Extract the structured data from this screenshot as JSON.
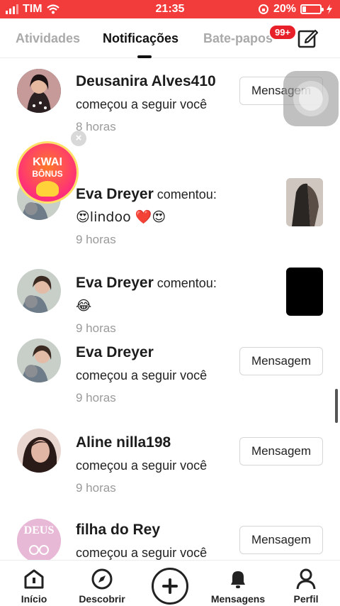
{
  "status_bar": {
    "carrier": "TIM",
    "time": "21:35",
    "battery": "20%",
    "battery_level": 0.2
  },
  "tabs": [
    {
      "label": "Atividades"
    },
    {
      "label": "Notificações"
    },
    {
      "label": "Bate-papos"
    }
  ],
  "chat_badge": "99+",
  "kwai_bonus": {
    "line1": "KWAI",
    "line2": "BÔNUS",
    "close": "×"
  },
  "notifications": [
    {
      "user": "Deusanira Alves410",
      "action": "começou a seguir você",
      "time": "8 horas",
      "button": "Mensagem"
    },
    {
      "user": "Eva Dreyer",
      "action": "comentou:",
      "comment": "😍lindoo ❤️😍",
      "time": "9 horas"
    },
    {
      "user": "Eva Dreyer",
      "action": "comentou:",
      "comment": "😂",
      "time": "9 horas"
    },
    {
      "user": "Eva Dreyer",
      "action": "começou a seguir você",
      "time": "9 horas",
      "button": "Mensagem"
    },
    {
      "user": "Aline nilla198",
      "action": "começou a seguir você",
      "time": "9 horas",
      "button": "Mensagem"
    },
    {
      "user": "filha do Rey",
      "action": "começou a seguir você",
      "button": "Mensagem",
      "avatar_text": "DEUS"
    }
  ],
  "bottom_nav": [
    {
      "label": "Início",
      "icon": "home-icon"
    },
    {
      "label": "Descobrir",
      "icon": "compass-icon"
    },
    {
      "label": "",
      "icon": "plus-icon"
    },
    {
      "label": "Mensagens",
      "icon": "bell-icon"
    },
    {
      "label": "Perfil",
      "icon": "person-icon"
    }
  ]
}
